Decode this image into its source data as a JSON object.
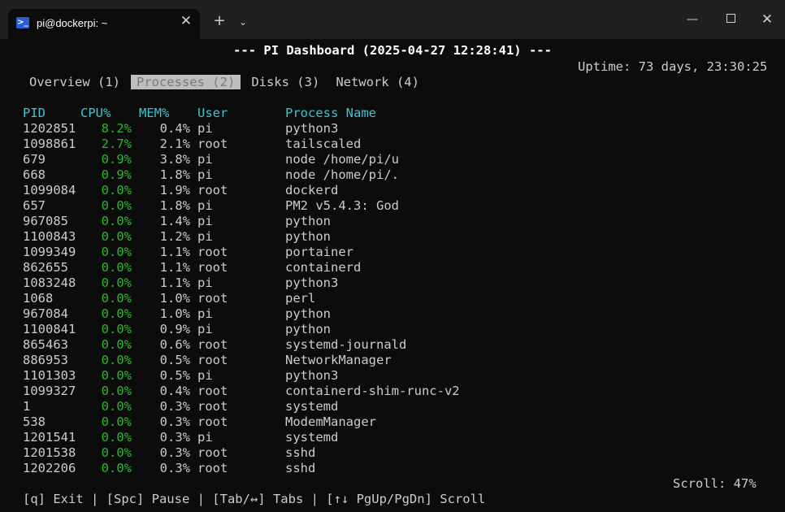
{
  "window": {
    "tab_title": "pi@dockerpi: ~",
    "tab_icon": "powershell-icon",
    "new_tab": "+",
    "dropdown": "⌄",
    "minimize": "—",
    "close": "✕"
  },
  "dashboard": {
    "title": "--- PI Dashboard (2025-04-27 12:28:41) ---",
    "uptime": "Uptime: 73 days, 23:30:25",
    "tabs": [
      "Overview (1)",
      "Processes (2)",
      "Disks (3)",
      "Network (4)"
    ],
    "active_tab_index": 1,
    "columns": [
      "PID",
      "CPU%",
      "MEM%",
      "User",
      "Process Name"
    ],
    "rows": [
      [
        "1202851",
        "8.2%",
        "0.4%",
        "pi",
        "python3"
      ],
      [
        "1098861",
        "2.7%",
        "2.1%",
        "root",
        "tailscaled"
      ],
      [
        "679",
        "0.9%",
        "3.8%",
        "pi",
        "node /home/pi/u"
      ],
      [
        "668",
        "0.9%",
        "1.8%",
        "pi",
        "node /home/pi/."
      ],
      [
        "1099084",
        "0.0%",
        "1.9%",
        "root",
        "dockerd"
      ],
      [
        "657",
        "0.0%",
        "1.8%",
        "pi",
        "PM2 v5.4.3: God"
      ],
      [
        "967085",
        "0.0%",
        "1.4%",
        "pi",
        "python"
      ],
      [
        "1100843",
        "0.0%",
        "1.2%",
        "pi",
        "python"
      ],
      [
        "1099349",
        "0.0%",
        "1.1%",
        "root",
        "portainer"
      ],
      [
        "862655",
        "0.0%",
        "1.1%",
        "root",
        "containerd"
      ],
      [
        "1083248",
        "0.0%",
        "1.1%",
        "pi",
        "python3"
      ],
      [
        "1068",
        "0.0%",
        "1.0%",
        "root",
        "perl"
      ],
      [
        "967084",
        "0.0%",
        "1.0%",
        "pi",
        "python"
      ],
      [
        "1100841",
        "0.0%",
        "0.9%",
        "pi",
        "python"
      ],
      [
        "865463",
        "0.0%",
        "0.6%",
        "root",
        "systemd-journald"
      ],
      [
        "886953",
        "0.0%",
        "0.5%",
        "root",
        "NetworkManager"
      ],
      [
        "1101303",
        "0.0%",
        "0.5%",
        "pi",
        "python3"
      ],
      [
        "1099327",
        "0.0%",
        "0.4%",
        "root",
        "containerd-shim-runc-v2"
      ],
      [
        "1",
        "0.0%",
        "0.3%",
        "root",
        "systemd"
      ],
      [
        "538",
        "0.0%",
        "0.3%",
        "root",
        "ModemManager"
      ],
      [
        "1201541",
        "0.0%",
        "0.3%",
        "pi",
        "systemd"
      ],
      [
        "1201538",
        "0.0%",
        "0.3%",
        "root",
        "sshd"
      ],
      [
        "1202206",
        "0.0%",
        "0.3%",
        "root",
        "sshd"
      ]
    ],
    "scroll": "Scroll: 47%",
    "footer": "[q] Exit | [Spc] Pause | [Tab/↔] Tabs | [↑↓ PgUp/PgDn] Scroll"
  },
  "colors": {
    "background": "#0c0c0c",
    "header_cyan": "#3cc6d1",
    "cpu_green": "#25bc24",
    "active_tab_bg": "#bebebe"
  }
}
